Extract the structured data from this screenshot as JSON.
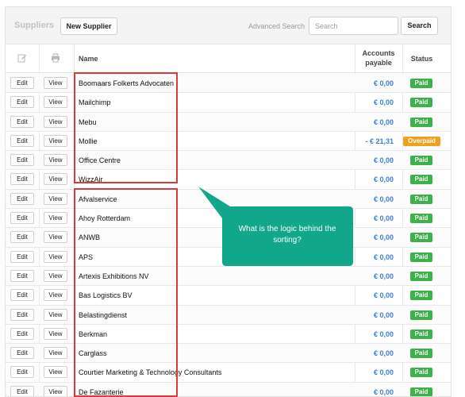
{
  "toolbar": {
    "title": "Suppliers",
    "new_supplier_label": "New Supplier",
    "advanced_search_label": "Advanced Search",
    "search_placeholder": "Search",
    "search_value": "",
    "search_button_label": "Search"
  },
  "header": {
    "edit_icon": "pencil-icon",
    "print_icon": "printer-icon",
    "name": "Name",
    "accounts_payable_line1": "Accounts",
    "accounts_payable_line2": "payable",
    "status": "Status"
  },
  "colors": {
    "paid": "#3cb34a",
    "overpaid": "#f0a020",
    "amount": "#3a7fd5",
    "highlight": "#d93a3a",
    "callout": "#12a68a"
  },
  "rows": [
    {
      "edit": "Edit",
      "view": "View",
      "name": "Boomaars Folkerts Advocaten",
      "amount": "€ 0,00",
      "status": "Paid"
    },
    {
      "edit": "Edit",
      "view": "View",
      "name": "Mailchimp",
      "amount": "€ 0,00",
      "status": "Paid"
    },
    {
      "edit": "Edit",
      "view": "View",
      "name": "Mebu",
      "amount": "€ 0,00",
      "status": "Paid"
    },
    {
      "edit": "Edit",
      "view": "View",
      "name": "Mollie",
      "amount": "- € 21,31",
      "status": "Overpaid"
    },
    {
      "edit": "Edit",
      "view": "View",
      "name": "Office Centre",
      "amount": "€ 0,00",
      "status": "Paid"
    },
    {
      "edit": "Edit",
      "view": "View",
      "name": "WizzAir",
      "amount": "€ 0,00",
      "status": "Paid"
    },
    {
      "edit": "Edit",
      "view": "View",
      "name": "Afvalservice",
      "amount": "€ 0,00",
      "status": "Paid"
    },
    {
      "edit": "Edit",
      "view": "View",
      "name": "Ahoy Rotterdam",
      "amount": "€ 0,00",
      "status": "Paid"
    },
    {
      "edit": "Edit",
      "view": "View",
      "name": "ANWB",
      "amount": "€ 0,00",
      "status": "Paid"
    },
    {
      "edit": "Edit",
      "view": "View",
      "name": "APS",
      "amount": "€ 0,00",
      "status": "Paid"
    },
    {
      "edit": "Edit",
      "view": "View",
      "name": "Artexis Exhibitions NV",
      "amount": "€ 0,00",
      "status": "Paid"
    },
    {
      "edit": "Edit",
      "view": "View",
      "name": "Bas Logistics BV",
      "amount": "€ 0,00",
      "status": "Paid"
    },
    {
      "edit": "Edit",
      "view": "View",
      "name": "Belastingdienst",
      "amount": "€ 0,00",
      "status": "Paid"
    },
    {
      "edit": "Edit",
      "view": "View",
      "name": "Berkman",
      "amount": "€ 0,00",
      "status": "Paid"
    },
    {
      "edit": "Edit",
      "view": "View",
      "name": "Carglass",
      "amount": "€ 0,00",
      "status": "Paid"
    },
    {
      "edit": "Edit",
      "view": "View",
      "name": "Courtier Marketing & Technology Consultants",
      "amount": "€ 0,00",
      "status": "Paid"
    },
    {
      "edit": "Edit",
      "view": "View",
      "name": "De Fazanterie",
      "amount": "€ 0,00",
      "status": "Paid"
    }
  ],
  "callout": {
    "line1": "What is the logic behind the",
    "line2": "sorting?"
  }
}
